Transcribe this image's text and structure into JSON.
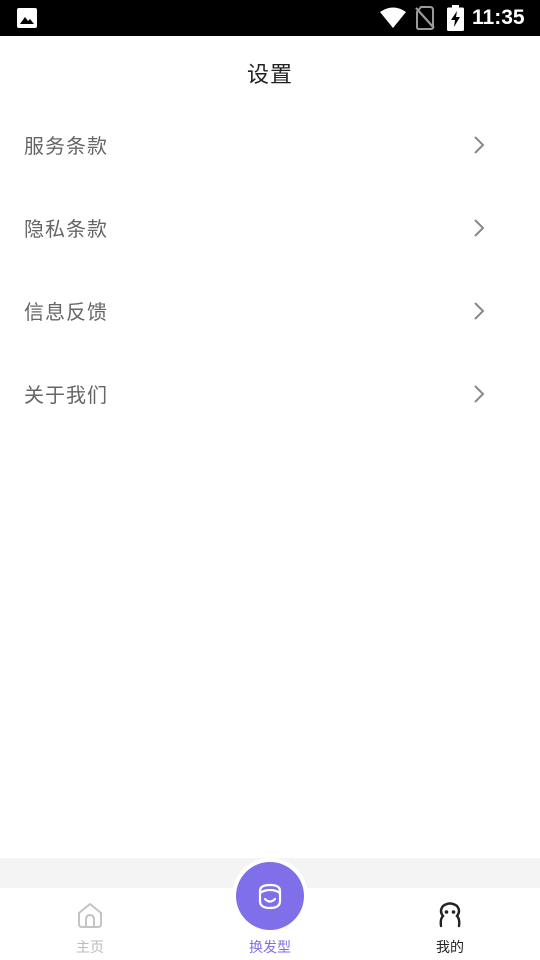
{
  "status_bar": {
    "time": "11:35",
    "icons": [
      "gallery-icon",
      "wifi-icon",
      "no-sim-icon",
      "battery-charging-icon"
    ]
  },
  "header": {
    "title": "设置"
  },
  "menu": {
    "items": [
      {
        "label": "服务条款",
        "icon": "chevron-right-icon"
      },
      {
        "label": "隐私条款",
        "icon": "chevron-right-icon"
      },
      {
        "label": "信息反馈",
        "icon": "chevron-right-icon"
      },
      {
        "label": "关于我们",
        "icon": "chevron-right-icon"
      }
    ]
  },
  "tabbar": {
    "tabs": [
      {
        "label": "主页",
        "icon": "home-icon",
        "color": "#bbbbbb"
      },
      {
        "label": "换发型",
        "icon": "hairstyle-icon",
        "color": "#7f6fe8"
      },
      {
        "label": "我的",
        "icon": "profile-icon",
        "color": "#222222",
        "active": true
      }
    ]
  },
  "colors": {
    "accent": "#7f6fe8",
    "text": "#666666",
    "title": "#222222"
  }
}
